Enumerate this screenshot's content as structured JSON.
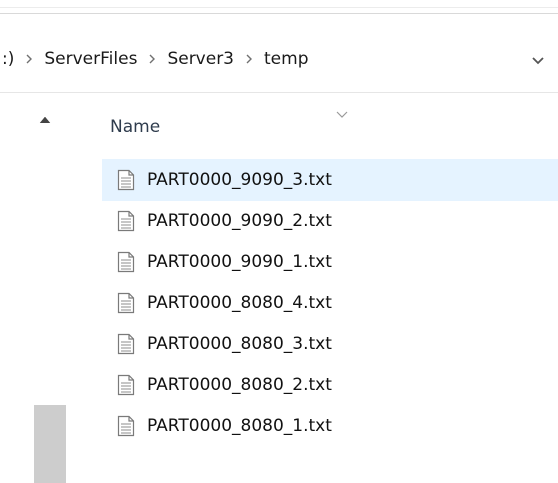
{
  "address_bar": {
    "crumbs": [
      ":)",
      "ServerFiles",
      "Server3",
      "temp"
    ]
  },
  "column_header": {
    "name_label": "Name"
  },
  "files": [
    {
      "name": "PART0000_9090_3.txt",
      "selected": true
    },
    {
      "name": "PART0000_9090_2.txt",
      "selected": false
    },
    {
      "name": "PART0000_9090_1.txt",
      "selected": false
    },
    {
      "name": "PART0000_8080_4.txt",
      "selected": false
    },
    {
      "name": "PART0000_8080_3.txt",
      "selected": false
    },
    {
      "name": "PART0000_8080_2.txt",
      "selected": false
    },
    {
      "name": "PART0000_8080_1.txt",
      "selected": false
    }
  ],
  "icons": {
    "crumb_separator": "chevron-right-icon",
    "address_dropdown": "chevron-down-icon",
    "scroll_up": "chevron-up-icon",
    "sort_indicator": "sort-chevron-down-icon",
    "file": "text-file-icon"
  },
  "colors": {
    "selection": "#e5f3ff",
    "scroll_thumb": "#cdcdcd",
    "header_text": "#2f3c4d"
  }
}
